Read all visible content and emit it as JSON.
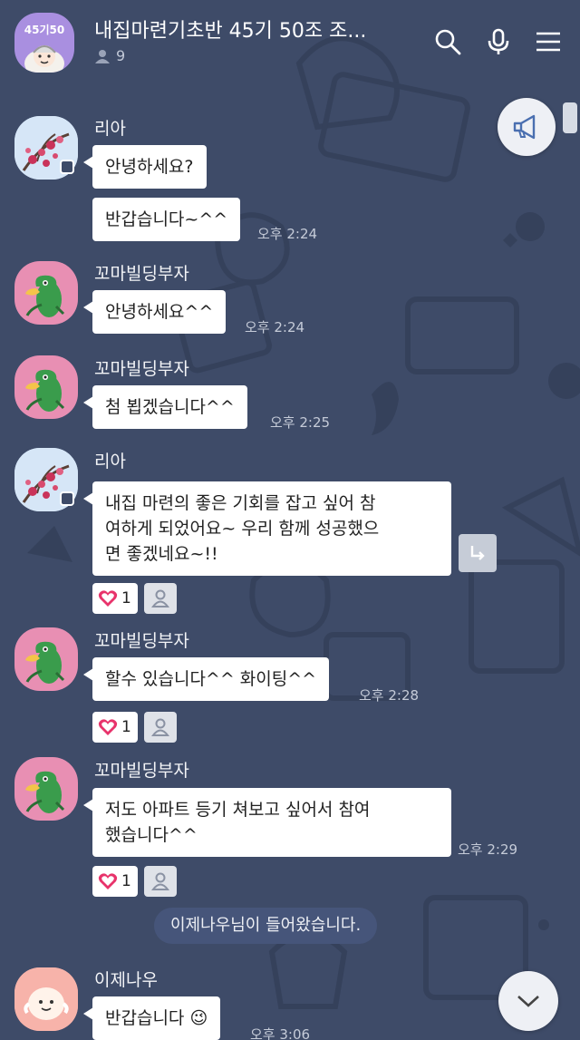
{
  "header": {
    "room_avatar_text": "45기50",
    "title": "내집마련기초반 45기 50조 조...",
    "member_count": "9",
    "icons": [
      "search-icon",
      "microphone-icon",
      "menu-icon"
    ]
  },
  "messages": [
    {
      "sender": "리아",
      "bubbles": [
        "안녕하세요?",
        "반갑습니다~^^"
      ],
      "time": "오후 2:24"
    },
    {
      "sender": "꼬마빌딩부자",
      "bubbles": [
        "안녕하세요^^"
      ],
      "time": "오후 2:24"
    },
    {
      "sender": "꼬마빌딩부자",
      "bubbles": [
        "첨 뵙겠습니다^^"
      ],
      "time": "오후 2:25"
    },
    {
      "sender": "리아",
      "bubbles": [
        "내집 마련의 좋은 기회를 잡고 싶어 참",
        "여하게 되었어요~ 우리 함께 성공했으",
        "면 좋겠네요~!!"
      ],
      "reactions": "1"
    },
    {
      "sender": "꼬마빌딩부자",
      "bubbles": [
        "할수 있습니다^^ 화이팅^^"
      ],
      "time": "오후 2:28",
      "reactions": "1"
    },
    {
      "sender": "꼬마빌딩부자",
      "bubbles": [
        "저도 아파트 등기 쳐보고 싶어서 참여",
        "했습니다^^"
      ],
      "time": "오후 2:29",
      "reactions": "1"
    },
    {
      "sender": "이제나우",
      "bubbles": [
        "반갑습니다 😉"
      ],
      "time": "오후 3:06"
    }
  ],
  "system_message": "이제나우님이 들어왔습니다.",
  "colors": {
    "background": "#3e4b68",
    "bubble": "#ffffff",
    "heart": "#e8336b",
    "accent": "#4a6fb0"
  }
}
